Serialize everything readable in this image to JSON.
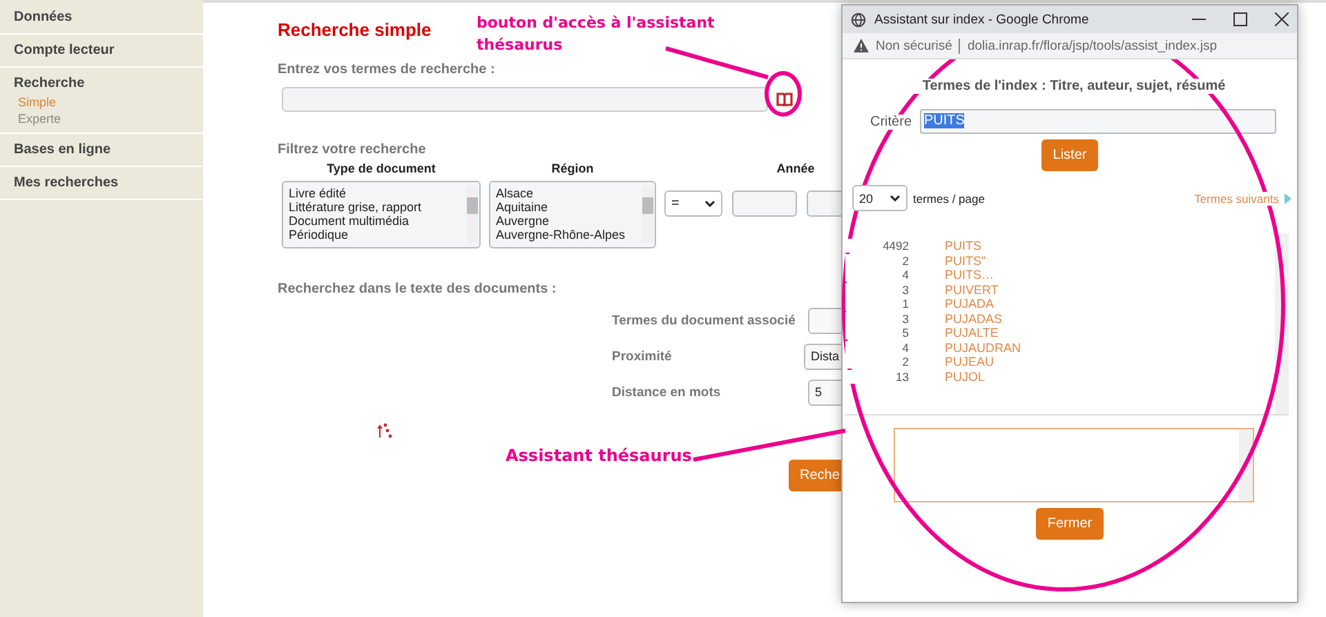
{
  "sidebar": {
    "items": [
      {
        "label": "Données"
      },
      {
        "label": "Compte lecteur"
      },
      {
        "label": "Recherche",
        "sub": [
          {
            "label": "Simple",
            "selected": true
          },
          {
            "label": "Experte",
            "selected": false
          }
        ]
      },
      {
        "label": "Bases en ligne"
      },
      {
        "label": "Mes recherches"
      }
    ]
  },
  "main": {
    "title": "Recherche simple",
    "search_label": "Entrez vos termes de recherche :",
    "filter_label": "Filtrez votre recherche",
    "filter_columns": [
      {
        "heading": "Type de document",
        "options": [
          "Livre édité",
          "Littérature grise, rapport",
          "Document multimédia",
          "Périodique"
        ]
      },
      {
        "heading": "Région",
        "options": [
          "Alsace",
          "Aquitaine",
          "Auvergne",
          "Auvergne-Rhône-Alpes"
        ]
      }
    ],
    "year": {
      "heading": "Année",
      "operator": "="
    },
    "text_search_label": "Recherchez dans le texte des documents :",
    "text_fields": [
      {
        "label": "Termes du document associé",
        "kind": "input"
      },
      {
        "label": "Proximité",
        "kind": "select",
        "value": "Dista"
      },
      {
        "label": "Distance en mots",
        "kind": "input",
        "value": "5"
      }
    ],
    "submit": "Reche"
  },
  "popup": {
    "window_title": "Assistant sur index - Google Chrome",
    "security": "Non sécurisé",
    "url": "dolia.inrap.fr/flora/jsp/tools/assist_index.jsp",
    "heading": "Termes de l'index : Titre, auteur, sujet, résumé",
    "criterion_label": "Critère",
    "criterion_value": "PUITS",
    "list_button": "Lister",
    "per_page": "20",
    "per_page_label": "termes / page",
    "next_link": "Termes suivants",
    "terms": [
      {
        "count": "4492",
        "term": "PUITS"
      },
      {
        "count": "2",
        "term": "PUITS\""
      },
      {
        "count": "4",
        "term": "PUITS…"
      },
      {
        "count": "3",
        "term": "PUIVERT"
      },
      {
        "count": "1",
        "term": "PUJADA"
      },
      {
        "count": "3",
        "term": "PUJADAS"
      },
      {
        "count": "5",
        "term": "PUJALTE"
      },
      {
        "count": "4",
        "term": "PUJAUDRAN"
      },
      {
        "count": "2",
        "term": "PUJEAU"
      },
      {
        "count": "13",
        "term": "PUJOL"
      }
    ],
    "close_button": "Fermer"
  },
  "annotations": [
    {
      "text": "bouton d'accès à l'assistant thésaurus"
    },
    {
      "text": "Assistant thésaurus"
    }
  ]
}
